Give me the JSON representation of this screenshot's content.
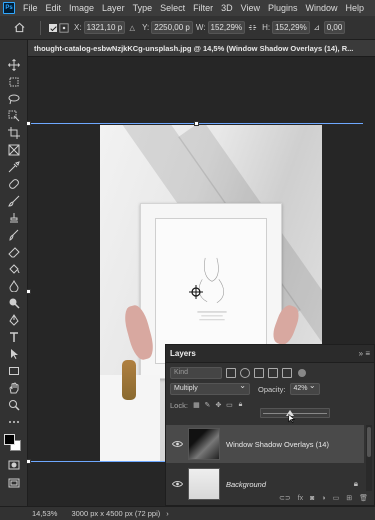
{
  "menu": {
    "logo": "Ps",
    "items": [
      "File",
      "Edit",
      "Image",
      "Layer",
      "Type",
      "Select",
      "Filter",
      "3D",
      "View",
      "Plugins",
      "Window",
      "Help"
    ]
  },
  "options": {
    "x_label": "X:",
    "x_value": "1321,10 p",
    "y_label": "Y:",
    "y_value": "2250,00 p",
    "w_label": "W:",
    "w_value": "152,29%",
    "h_label": "H:",
    "h_value": "152,29%",
    "rot_value": "0,00"
  },
  "document": {
    "tab_title": "thought-catalog-esbwNzjkKCg-unsplash.jpg @ 14,5% (Window Shadow Overlays (14), R..."
  },
  "layers_panel": {
    "title": "Layers",
    "search_placeholder": "Kind",
    "blend_mode": "Multiply",
    "opacity_label": "Opacity:",
    "opacity_value": "42%",
    "opacity_fraction": 0.42,
    "lock_label": "Lock:",
    "layers": [
      {
        "name": "Window Shadow Overlays (14)",
        "selected": true
      },
      {
        "name": "Background",
        "italic": true
      }
    ]
  },
  "status": {
    "zoom": "14,53%",
    "doc_info": "3000 px x 4500 px (72 ppi)"
  }
}
